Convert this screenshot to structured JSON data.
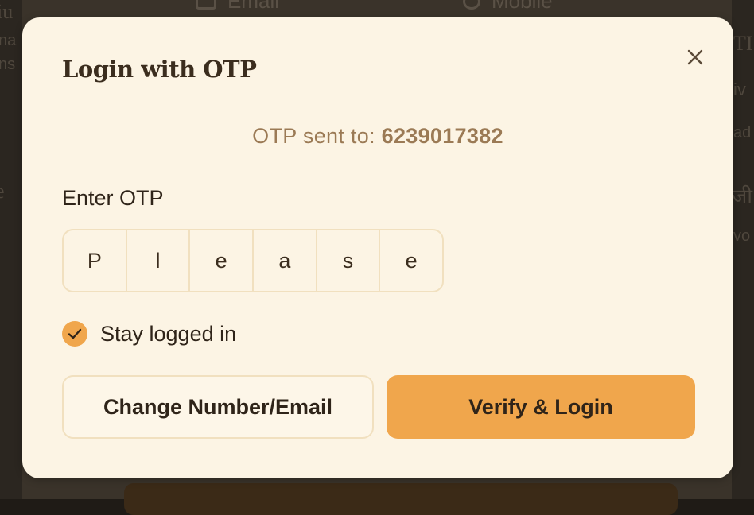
{
  "background": {
    "tabs": [
      {
        "label": "Email",
        "icon": "mail-icon"
      },
      {
        "label": "Mobile",
        "icon": "phone-icon"
      }
    ]
  },
  "modal": {
    "title": "Login with OTP",
    "close_icon": "close-icon",
    "otp_sent_prefix": "OTP sent to:",
    "otp_sent_number": "6239017382",
    "enter_otp_label": "Enter OTP",
    "otp_digits": [
      "P",
      "l",
      "e",
      "a",
      "s",
      "e"
    ],
    "stay_logged_in": {
      "label": "Stay logged in",
      "checked": true
    },
    "change_button_label": "Change Number/Email",
    "verify_button_label": "Verify & Login"
  },
  "colors": {
    "modal_bg": "#fcf4e4",
    "accent": "#f0a64c",
    "muted_text": "#9b7a55",
    "border": "#f1e0bf"
  }
}
